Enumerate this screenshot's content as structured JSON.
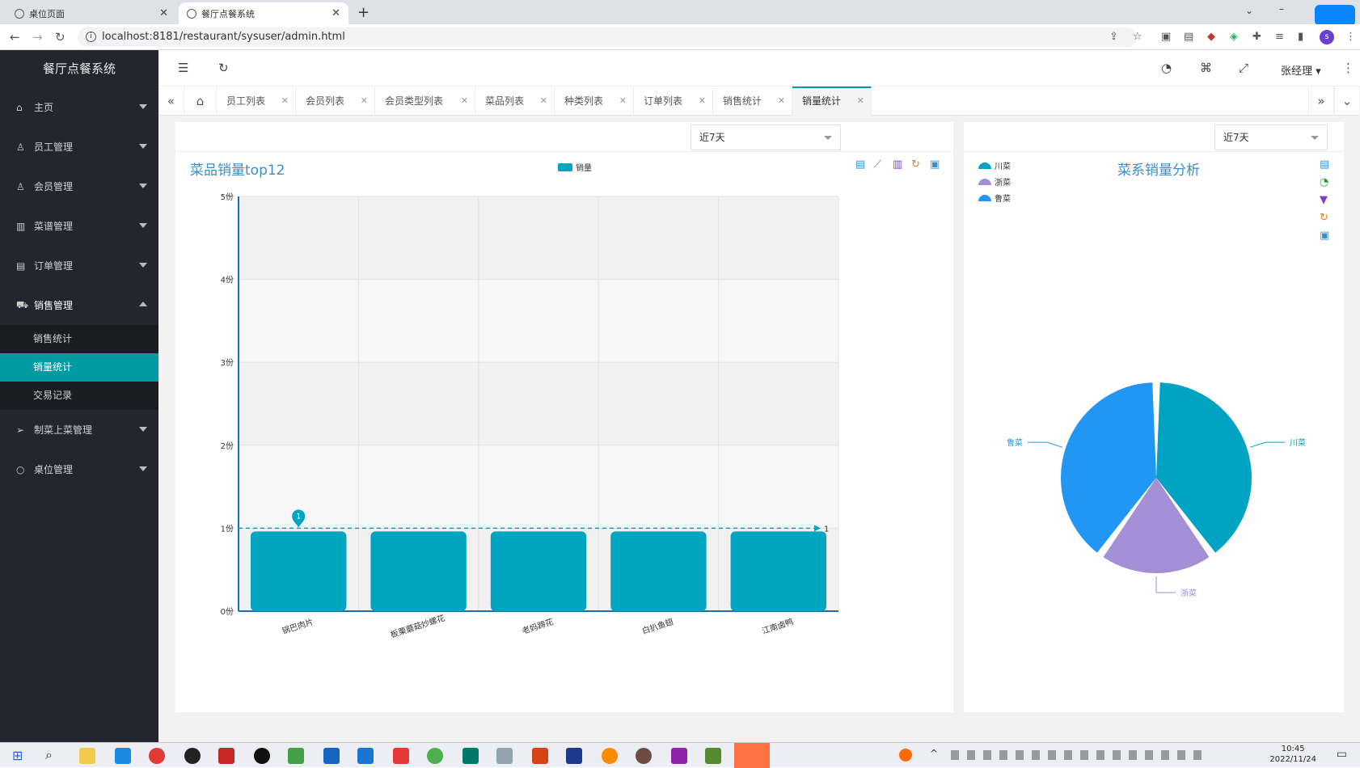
{
  "browser": {
    "tabs": [
      {
        "title": "桌位页面"
      },
      {
        "title": "餐厅点餐系统"
      }
    ],
    "url": "localhost:8181/restaurant/sysuser/admin.html"
  },
  "app": {
    "title": "餐厅点餐系统",
    "user": "张经理",
    "sidebar": [
      {
        "label": "主页",
        "icon": "home-icon"
      },
      {
        "label": "员工管理",
        "icon": "user-icon"
      },
      {
        "label": "会员管理",
        "icon": "person-icon"
      },
      {
        "label": "菜谱管理",
        "icon": "book-icon"
      },
      {
        "label": "订单管理",
        "icon": "list-icon"
      },
      {
        "label": "销售管理",
        "icon": "cart-icon",
        "open": true,
        "children": [
          "销售统计",
          "销量统计",
          "交易记录"
        ],
        "active_child": 1
      },
      {
        "label": "制菜上菜管理",
        "icon": "send-icon"
      },
      {
        "label": "桌位管理",
        "icon": "circle-icon"
      }
    ],
    "page_tabs": [
      "员工列表",
      "会员列表",
      "会员类型列表",
      "菜品列表",
      "种类列表",
      "订单列表",
      "销售统计",
      "销量统计"
    ],
    "active_page_tab": 7
  },
  "left_panel": {
    "range_select": "近7天",
    "title": "菜品销量top12",
    "legend": "销量",
    "markpoint_label": "1",
    "markline_label": "1"
  },
  "right_panel": {
    "range_select": "近7天",
    "title": "菜系销量分析",
    "legend": [
      "川菜",
      "浙菜",
      "鲁菜"
    ]
  },
  "chart_data": [
    {
      "type": "bar",
      "title": "菜品销量top12",
      "categories": [
        "锅巴肉片",
        "板栗蘑菇炒螺花",
        "老妈蹄花",
        "白扒鱼翅",
        "江南卤鸭"
      ],
      "series": [
        {
          "name": "销量",
          "values": [
            1,
            1,
            1,
            1,
            1
          ]
        }
      ],
      "ylim": [
        0,
        5
      ],
      "yticks": [
        "0份",
        "1份",
        "2份",
        "3份",
        "4份",
        "5份"
      ],
      "markline": {
        "value": 1
      },
      "markpoint": {
        "category": "锅巴肉片",
        "value": 1
      },
      "grid": true,
      "legend_position": "top-center",
      "color": "#00a6bf"
    },
    {
      "type": "pie",
      "title": "菜系销量分析",
      "slices": [
        {
          "name": "川菜",
          "value": 2,
          "color": "#00a3c2"
        },
        {
          "name": "浙菜",
          "value": 1,
          "color": "#a48ed6"
        },
        {
          "name": "鲁菜",
          "value": 2,
          "color": "#2196f3"
        }
      ],
      "legend_position": "top-left"
    }
  ],
  "taskbar": {
    "time": "10:45",
    "date": "2022/11/24"
  }
}
